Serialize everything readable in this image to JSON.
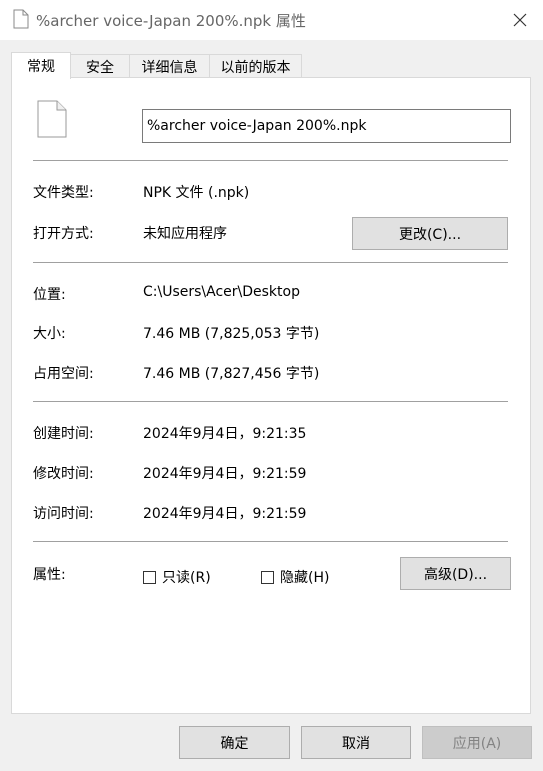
{
  "window": {
    "title": "%archer voice-Japan 200%.npk 属性"
  },
  "tabs": [
    {
      "label": "常规"
    },
    {
      "label": "安全"
    },
    {
      "label": "详细信息"
    },
    {
      "label": "以前的版本"
    }
  ],
  "general": {
    "file_name": "%archer voice-Japan 200%.npk",
    "file_type_label": "文件类型:",
    "file_type_value": "NPK 文件 (.npk)",
    "open_with_label": "打开方式:",
    "open_with_value": "未知应用程序",
    "change_button": "更改(C)...",
    "location_label": "位置:",
    "location_value": "C:\\Users\\Acer\\Desktop",
    "size_label": "大小:",
    "size_value": "7.46 MB (7,825,053 字节)",
    "size_on_disk_label": "占用空间:",
    "size_on_disk_value": "7.46 MB (7,827,456 字节)",
    "created_label": "创建时间:",
    "created_value": "2024年9月4日，9:21:35",
    "modified_label": "修改时间:",
    "modified_value": "2024年9月4日，9:21:59",
    "accessed_label": "访问时间:",
    "accessed_value": "2024年9月4日，9:21:59",
    "attributes_label": "属性:",
    "readonly_label": "只读(R)",
    "readonly_checked": false,
    "hidden_label": "隐藏(H)",
    "hidden_checked": false,
    "advanced_button": "高级(D)..."
  },
  "footer": {
    "ok_button": "确定",
    "cancel_button": "取消",
    "apply_button": "应用(A)"
  },
  "icons": {
    "title": "document-icon",
    "close": "close-icon",
    "file": "file-icon"
  }
}
